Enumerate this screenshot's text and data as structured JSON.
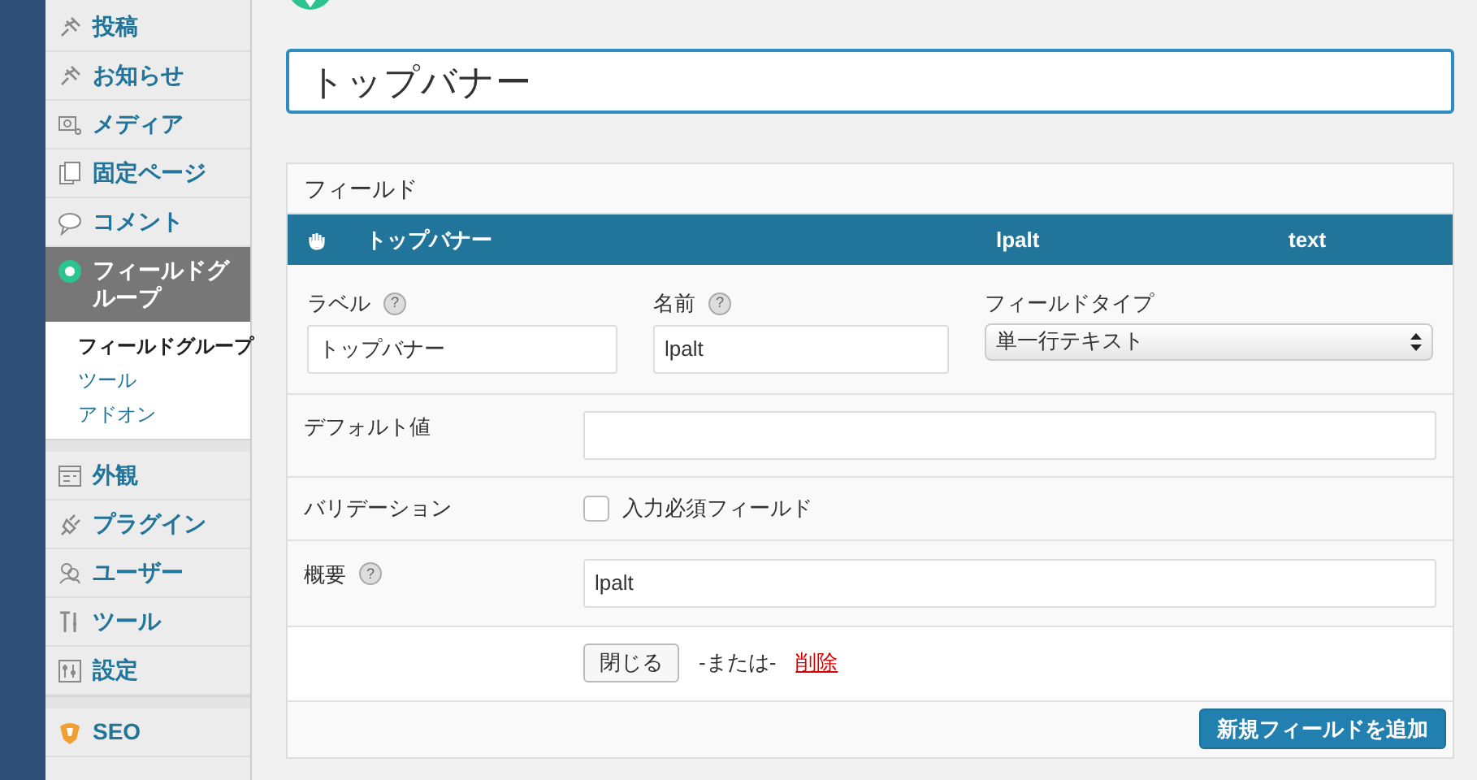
{
  "sidebar": {
    "groups": [
      {
        "items": [
          {
            "label": "投稿",
            "selected": false
          },
          {
            "label": "お知らせ",
            "selected": false
          },
          {
            "label": "メディア",
            "selected": false
          },
          {
            "label": "固定ページ",
            "selected": false
          },
          {
            "label": "コメント",
            "selected": false
          },
          {
            "label": "フィールドグループ",
            "selected": true,
            "children": [
              {
                "label": "フィールドグループ",
                "selected": true
              },
              {
                "label": "ツール",
                "selected": false
              },
              {
                "label": "アドオン",
                "selected": false
              }
            ]
          }
        ]
      },
      {
        "items": [
          {
            "label": "外観",
            "selected": false
          },
          {
            "label": "プラグイン",
            "selected": false
          },
          {
            "label": "ユーザー",
            "selected": false
          },
          {
            "label": "ツール",
            "selected": false
          },
          {
            "label": "設定",
            "selected": false
          }
        ]
      },
      {
        "items": [
          {
            "label": "SEO",
            "selected": false
          }
        ]
      }
    ]
  },
  "title_field": {
    "value": "トップバナー"
  },
  "fields_panel": {
    "title": "フィールド",
    "field_row": {
      "label": "トップバナー",
      "name": "lpalt",
      "type": "text"
    },
    "settings": {
      "label": {
        "caption": "ラベル",
        "help": "?",
        "value": "トップバナー"
      },
      "name": {
        "caption": "名前",
        "help": "?",
        "value": "lpalt"
      },
      "field_type": {
        "caption": "フィールドタイプ",
        "value": "単一行テキスト"
      },
      "default_value": {
        "caption": "デフォルト値"
      },
      "validation": {
        "caption": "バリデーション",
        "checkbox_label": "入力必須フィールド",
        "checked": false
      },
      "description": {
        "caption": "概要",
        "help": "?",
        "value": "lpalt"
      },
      "close_button": "閉じる",
      "or_text": "-または-",
      "delete_link": "削除"
    },
    "add_button": "新規フィールドを追加"
  }
}
